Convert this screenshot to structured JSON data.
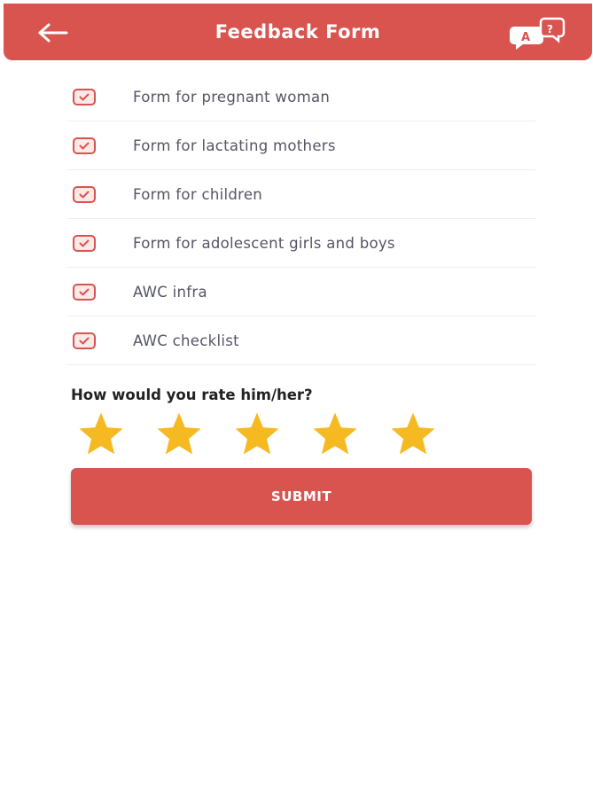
{
  "header": {
    "title": "Feedback Form",
    "back_icon": "arrow-left-icon",
    "chat_icon": "chat-bubbles-icon",
    "background_color": "#d9534f"
  },
  "forms": [
    {
      "label": "Form for pregnant woman",
      "checked": true
    },
    {
      "label": "Form for lactating mothers",
      "checked": true
    },
    {
      "label": "Form for children",
      "checked": true
    },
    {
      "label": "Form for adolescent girls and boys",
      "checked": true
    },
    {
      "label": "AWC infra",
      "checked": true
    },
    {
      "label": "AWC checklist",
      "checked": true
    }
  ],
  "rating": {
    "question": "How would you rate him/her?",
    "value": 5,
    "max": 5,
    "star_color": "#f5b921"
  },
  "submit_label": "SUBMIT"
}
